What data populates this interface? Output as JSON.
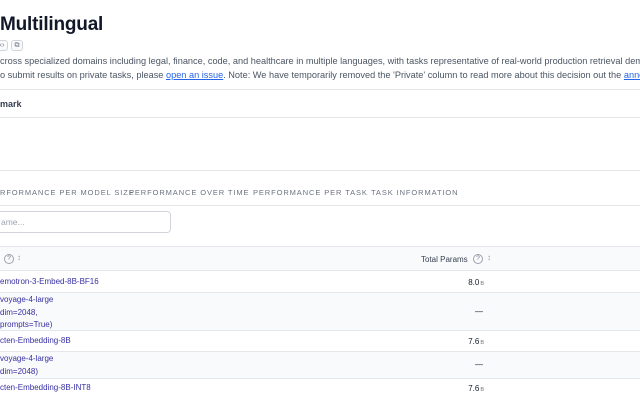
{
  "header": {
    "title": "Multilingual",
    "mini_buttons": [
      "code-icon",
      "copy-icon"
    ]
  },
  "description": {
    "line1": "cross specialized domains including legal, finance, code, and healthcare in multiple languages, with tasks representative of real-world production retrieval demands. Inclu",
    "line2_before": "o submit results on private tasks, please ",
    "line2_link1": "open an issue",
    "line2_middle": ". Note: We have temporarily removed the 'Private' column to read more about this decision out the ",
    "line2_link2": "announcement"
  },
  "benchmark_label": "mark",
  "tabs": [
    {
      "label": "RFORMANCE PER MODEL SIZE"
    },
    {
      "label": "PERFORMANCE OVER TIME"
    },
    {
      "label": "PERFORMANCE PER TASK"
    },
    {
      "label": "TASK INFORMATION"
    }
  ],
  "search": {
    "placeholder": "ame..."
  },
  "table": {
    "columns": [
      {
        "label": "",
        "help": "?",
        "sort": "↕"
      },
      {
        "label": "Total Params",
        "help": "?",
        "sort": "↕"
      }
    ],
    "rows": [
      {
        "model_lines": [
          "emotron-3-Embed-8B-BF16"
        ],
        "params": "8.0",
        "unit": "B"
      },
      {
        "model_lines": [
          "voyage-4-large",
          "dim=2048,",
          "prompts=True)"
        ],
        "params": "—",
        "unit": ""
      },
      {
        "model_lines": [
          "cten-Embedding-8B"
        ],
        "params": "7.6",
        "unit": "B"
      },
      {
        "model_lines": [
          "voyage-4-large",
          "dim=2048)"
        ],
        "params": "—",
        "unit": ""
      },
      {
        "model_lines": [
          "cten-Embedding-8B-INT8"
        ],
        "params": "7.6",
        "unit": "B"
      }
    ]
  }
}
